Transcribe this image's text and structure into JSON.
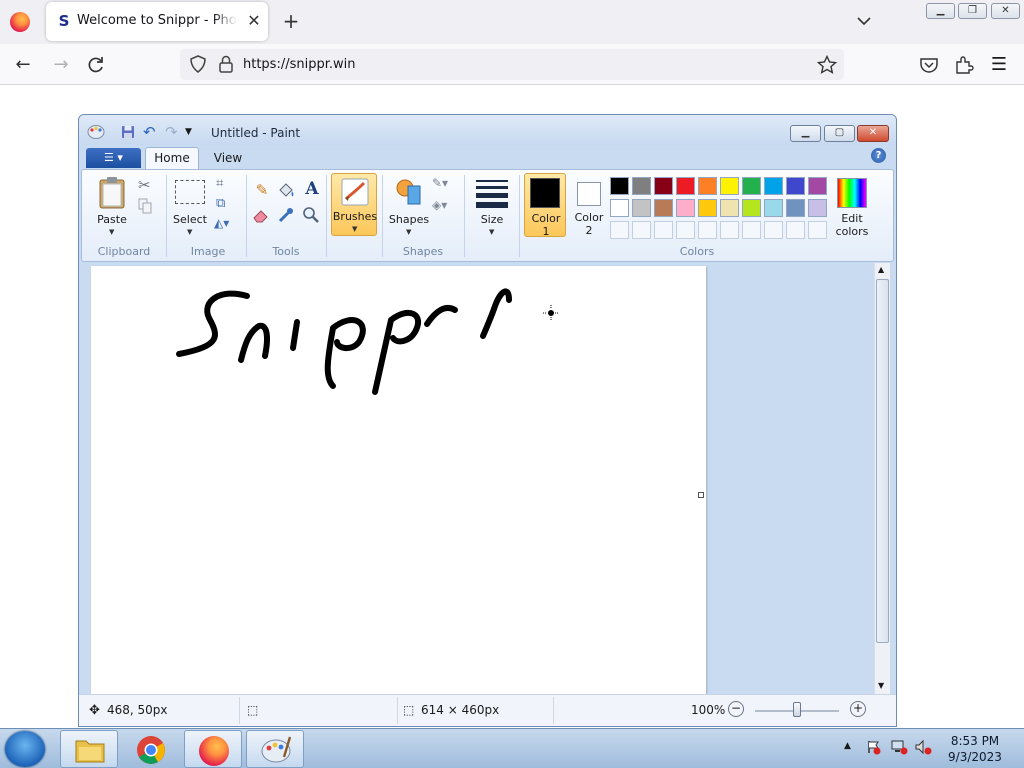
{
  "browser": {
    "tab_title": "Welcome to Snippr - Photo Sharing",
    "tab_favicon": "S",
    "url": "https://snippr.win"
  },
  "paint": {
    "window_title": "Untitled - Paint",
    "file_button_icon": "file-menu-icon",
    "tabs": {
      "home": "Home",
      "view": "View"
    },
    "ribbon": {
      "clipboard": {
        "label": "Clipboard",
        "paste": "Paste"
      },
      "image": {
        "label": "Image",
        "select": "Select"
      },
      "tools": {
        "label": "Tools"
      },
      "brushes": "Brushes",
      "shapes": {
        "label": "Shapes",
        "button": "Shapes"
      },
      "size": "Size",
      "color1": {
        "line1": "Color",
        "line2": "1"
      },
      "color2": {
        "line1": "Color",
        "line2": "2"
      },
      "colors": {
        "label": "Colors",
        "edit_line1": "Edit",
        "edit_line2": "colors"
      },
      "tool_text_glyph": "A"
    },
    "active_color1": "#000000",
    "active_color2": "#ffffff",
    "palette_row1": [
      "#000000",
      "#7f7f7f",
      "#880015",
      "#ed1c24",
      "#ff7f27",
      "#fff200",
      "#22b14c",
      "#00a2e8",
      "#3f48cc",
      "#a349a4"
    ],
    "palette_row2": [
      "#ffffff",
      "#c3c3c3",
      "#b97a57",
      "#ffaec9",
      "#ffc90e",
      "#efe4b0",
      "#b5e61d",
      "#99d9ea",
      "#7092be",
      "#c8bfe7"
    ],
    "status": {
      "cursor_pos": "468, 50px",
      "canvas_size": "614 × 460px",
      "zoom": "100%"
    }
  },
  "taskbar": {
    "time": "8:53 PM",
    "date": "9/3/2023"
  }
}
